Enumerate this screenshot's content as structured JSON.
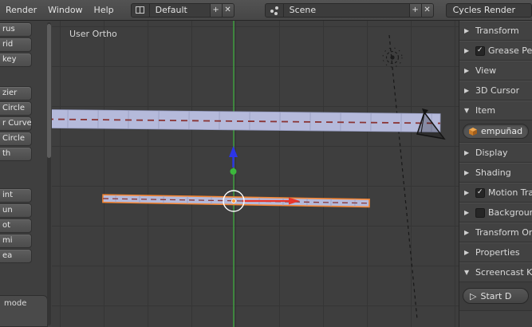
{
  "header": {
    "menus": [
      {
        "label": "Render"
      },
      {
        "label": "Window"
      },
      {
        "label": "Help"
      }
    ],
    "layout_selector": {
      "value": "Default",
      "add_label": "+",
      "close_label": "✕"
    },
    "scene_selector": {
      "value": "Scene",
      "add_label": "+",
      "close_label": "✕"
    },
    "engine_selector": {
      "value": "Cycles Render"
    }
  },
  "toolshelf": {
    "buttons": [
      {
        "label": "rus"
      },
      {
        "label": "rid"
      },
      {
        "label": "key"
      },
      {
        "label": "zier"
      },
      {
        "label": "Circle"
      },
      {
        "label": "r Curve"
      },
      {
        "label": "Circle"
      },
      {
        "label": "th"
      },
      {
        "label": "int"
      },
      {
        "label": "un"
      },
      {
        "label": "ot"
      },
      {
        "label": "mi"
      },
      {
        "label": "ea"
      }
    ],
    "footer_label": "mode"
  },
  "viewport": {
    "view_label": "User Ortho",
    "colors": {
      "background": "#3e3e3e",
      "grid_line": "#353535",
      "axis_green": "#3fa33f",
      "beam_fill": "#b5badb",
      "beam_dash_red": "#8a3434",
      "selection_outline_orange": "#f58634",
      "manipulator_red": "#e8352c",
      "manipulator_blue": "#2c35e8",
      "manipulator_green": "#3cb83c"
    }
  },
  "properties_panel": {
    "sections": [
      {
        "label": "Transform",
        "expanded": false
      },
      {
        "label": "Grease Pe",
        "expanded": false,
        "checked": true
      },
      {
        "label": "View",
        "expanded": false
      },
      {
        "label": "3D Cursor",
        "expanded": false
      },
      {
        "label": "Item",
        "expanded": true
      },
      {
        "label": "Display",
        "expanded": false
      },
      {
        "label": "Shading",
        "expanded": false
      },
      {
        "label": "Motion Tra",
        "expanded": false,
        "checked": true
      },
      {
        "label": "Backgroun",
        "expanded": false,
        "checked": false
      },
      {
        "label": "Transform Ori",
        "expanded": false
      },
      {
        "label": "Properties",
        "expanded": false
      },
      {
        "label": "Screencast Ke",
        "expanded": true
      }
    ],
    "item_name_value": "empuñadur",
    "start_button_label": "Start D"
  }
}
